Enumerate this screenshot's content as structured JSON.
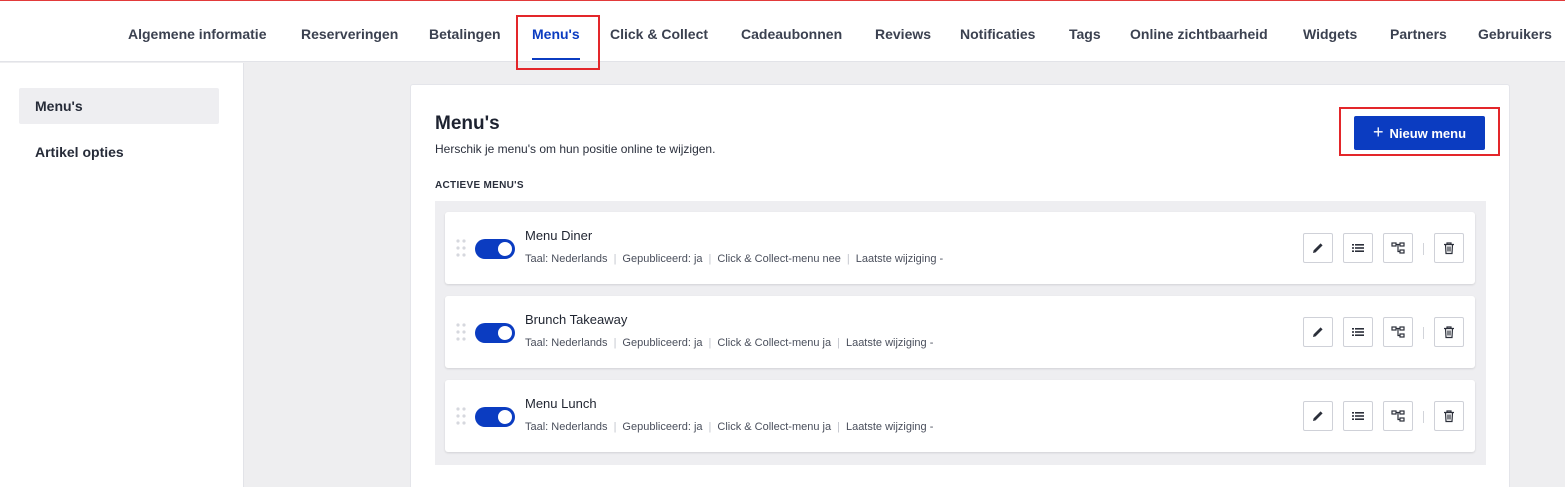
{
  "nav": {
    "tabs": [
      {
        "label": "Algemene informatie"
      },
      {
        "label": "Reserveringen"
      },
      {
        "label": "Betalingen"
      },
      {
        "label": "Menu's"
      },
      {
        "label": "Click & Collect"
      },
      {
        "label": "Cadeaubonnen"
      },
      {
        "label": "Reviews"
      },
      {
        "label": "Notificaties"
      },
      {
        "label": "Tags"
      },
      {
        "label": "Online zichtbaarheid"
      },
      {
        "label": "Widgets"
      },
      {
        "label": "Partners"
      },
      {
        "label": "Gebruikers"
      }
    ],
    "active": "Menu's"
  },
  "sidebar": {
    "items": [
      {
        "label": "Menu's"
      },
      {
        "label": "Artikel opties"
      }
    ]
  },
  "main": {
    "title": "Menu's",
    "subtitle": "Herschik je menu's om hun positie online te wijzigen.",
    "section_label": "ACTIEVE MENU'S",
    "new_button_label": "Nieuw menu",
    "menus": [
      {
        "name": "Menu Diner",
        "enabled": true,
        "meta": [
          "Taal: Nederlands",
          "Gepubliceerd: ja",
          "Click & Collect-menu nee",
          "Laatste wijziging -"
        ]
      },
      {
        "name": "Brunch Takeaway",
        "enabled": true,
        "meta": [
          "Taal: Nederlands",
          "Gepubliceerd: ja",
          "Click & Collect-menu ja",
          "Laatste wijziging -"
        ]
      },
      {
        "name": "Menu Lunch",
        "enabled": true,
        "meta": [
          "Taal: Nederlands",
          "Gepubliceerd: ja",
          "Click & Collect-menu ja",
          "Laatste wijziging -"
        ]
      }
    ]
  },
  "colors": {
    "accent": "#0b3cc1",
    "highlight": "#e3262a"
  },
  "icons": [
    "drag-handle-icon",
    "pencil-icon",
    "list-icon",
    "hierarchy-icon",
    "trash-icon",
    "plus-icon"
  ]
}
